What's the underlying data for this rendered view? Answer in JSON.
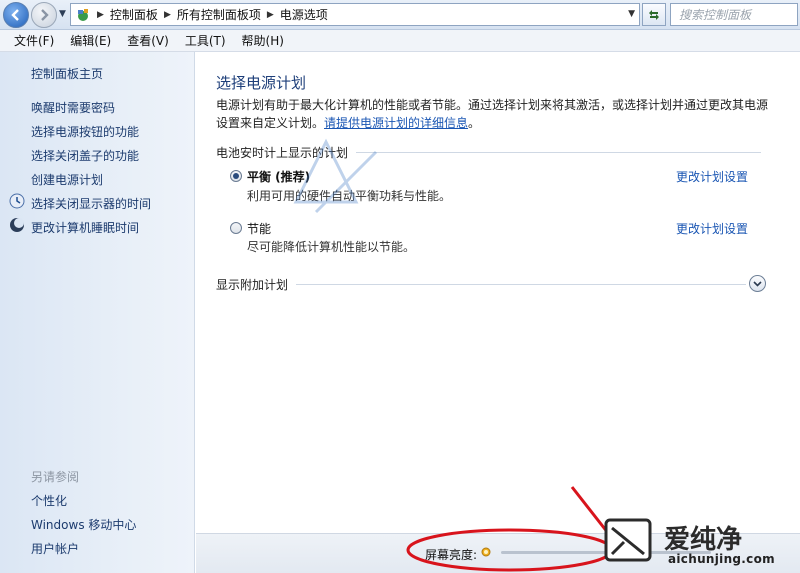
{
  "address_bar": {
    "breadcrumbs": [
      "控制面板",
      "所有控制面板项",
      "电源选项"
    ],
    "search_placeholder": "搜索控制面板"
  },
  "menu": [
    "文件(F)",
    "编辑(E)",
    "查看(V)",
    "工具(T)",
    "帮助(H)"
  ],
  "sidebar": {
    "home": "控制面板主页",
    "links": [
      {
        "label": "唤醒时需要密码",
        "icon": ""
      },
      {
        "label": "选择电源按钮的功能",
        "icon": ""
      },
      {
        "label": "选择关闭盖子的功能",
        "icon": ""
      },
      {
        "label": "创建电源计划",
        "icon": ""
      },
      {
        "label": "选择关闭显示器的时间",
        "icon": "display-timer-icon"
      },
      {
        "label": "更改计算机睡眠时间",
        "icon": "moon-sleep-icon"
      }
    ],
    "see_also_title": "另请参阅",
    "see_also": [
      "个性化",
      "Windows 移动中心",
      "用户帐户"
    ]
  },
  "main": {
    "title": "选择电源计划",
    "description": "电源计划有助于最大化计算机的性能或者节能。通过选择计划来将其激活，或选择计划并通过更改其电源设置来自定义计划。",
    "description_link": "请提供电源计划的详细信息",
    "description_end": "。",
    "battery_group": "电池安时计上显示的计划",
    "plans": [
      {
        "name": "平衡 (推荐)",
        "desc": "利用可用的硬件自动平衡功耗与性能。",
        "selected": true,
        "link": "更改计划设置"
      },
      {
        "name": "节能",
        "desc": "尽可能降低计算机性能以节能。",
        "selected": false,
        "link": "更改计划设置"
      }
    ],
    "additional_group": "显示附加计划"
  },
  "bottom": {
    "brightness_label": "屏幕亮度:"
  },
  "watermark": {
    "name": "爱纯净",
    "domain": "aichunjing.com"
  },
  "colors": {
    "accent_link": "#1a56b3",
    "annotation_red": "#d8141c",
    "title_blue": "#1e3f7a"
  }
}
